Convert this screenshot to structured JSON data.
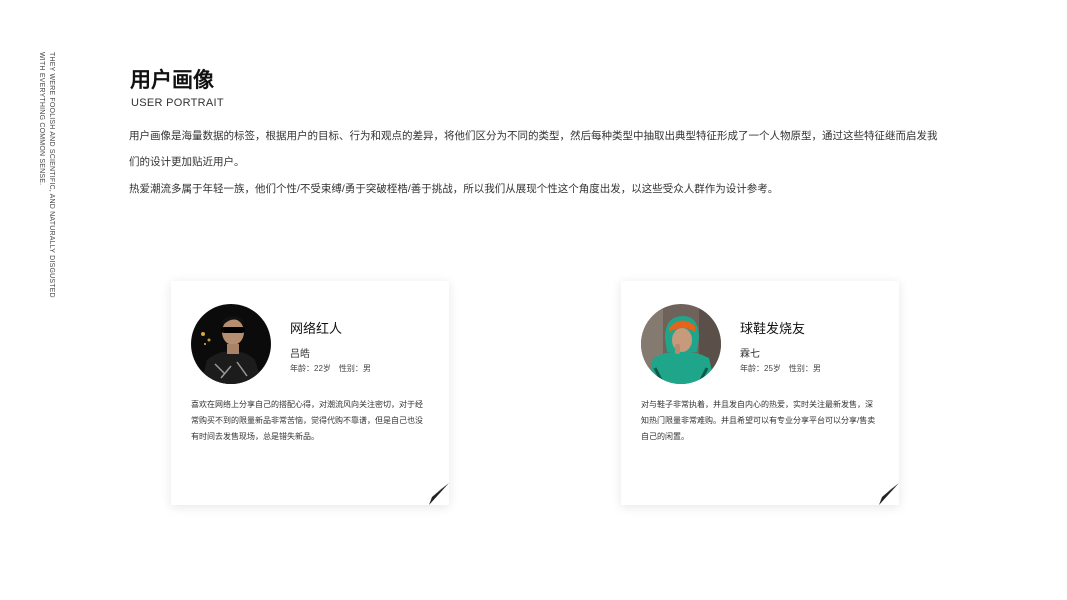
{
  "side_text": {
    "line1": "THEY WERE FOOLISH AND SCIENTIFIC, AND NATURALLY DISGUSTED",
    "line2": "WITH EVERYTHING COMMON SENSE."
  },
  "header": {
    "title": "用户画像",
    "subtitle": "USER PORTRAIT"
  },
  "intro": {
    "paragraph1": "用户画像是海量数据的标签，根据用户的目标、行为和观点的差异，将他们区分为不同的类型，然后每种类型中抽取出典型特征形成了一个人物原型，通过这些特征继而启发我们的设计更加贴近用户。",
    "paragraph2": "热爱潮流多属于年轻一族，他们个性/不受束缚/勇于突破桎梏/善于挑战，所以我们从展现个性这个角度出发，以这些受众人群作为设计参考。"
  },
  "personas": [
    {
      "role": "网络红人",
      "name": "吕皓",
      "age": "年龄：22岁",
      "gender": "性别：男",
      "description": "喜欢在网络上分享自己的搭配心得，对潮流风向关注密切，对于经常购买不到的限量新品非常苦恼，觉得代购不靠谱，但是自己也没有时间去发售现场，总是错失新品。"
    },
    {
      "role": "球鞋发烧友",
      "name": "霖七",
      "age": "年龄：25岁",
      "gender": "性别：男",
      "description": "对与鞋子非常执着，并且发自内心的热爱，实时关注最新发售，深知热门限量非常难购。并且希望可以有专业分享平台可以分享/售卖自己的闲置。"
    }
  ],
  "colors": {
    "background": "#ffffff",
    "text": "#222222",
    "card_shadow": "rgba(0,0,0,0.10)",
    "avatar2_jacket": "#1fa58a",
    "avatar2_hair": "#e8621c"
  }
}
